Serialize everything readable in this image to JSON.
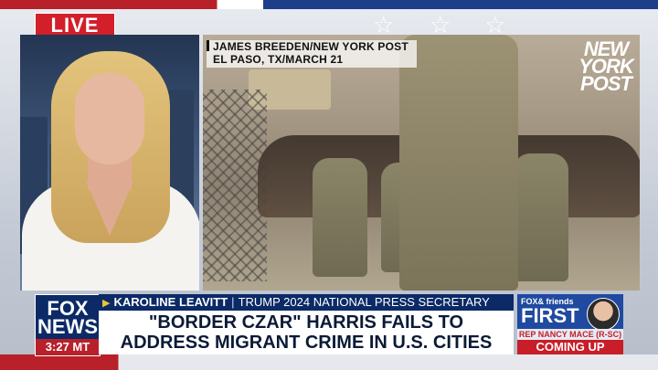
{
  "live_badge": "LIVE",
  "photo_credit": {
    "line1": "JAMES BREEDEN/NEW YORK POST",
    "line2": "EL PASO, TX/MARCH 21"
  },
  "watermark": {
    "line1": "NEW",
    "line2": "YORK",
    "line3": "POST"
  },
  "network_logo": {
    "line1": "FOX",
    "line2": "NEWS",
    "time": "3:27 MT"
  },
  "lower_third": {
    "name": "KAROLINE LEAVITT",
    "separator": "|",
    "title": "TRUMP 2024 NATIONAL PRESS SECRETARY",
    "headline_line1": "\"BORDER CZAR\" HARRIS FAILS TO",
    "headline_line2": "ADDRESS MIGRANT CRIME IN U.S. CITIES"
  },
  "promo": {
    "brand": "FOX& friends",
    "show": "FIRST",
    "guest": "REP NANCY MACE (R-SC)",
    "status": "COMING UP"
  },
  "colors": {
    "fox_blue": "#0b2a66",
    "fox_red": "#b8202a",
    "live_red": "#d21f2a",
    "promo_blue": "#1f4aa0"
  }
}
